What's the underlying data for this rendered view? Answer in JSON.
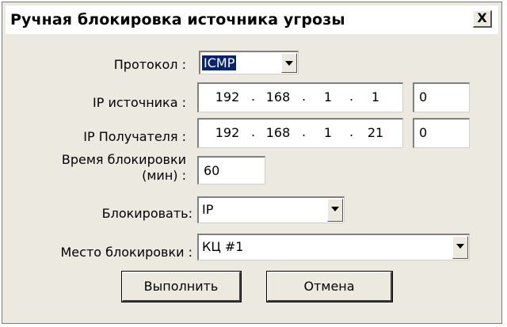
{
  "dialog": {
    "title": "Ручная блокировка источника угрозы",
    "close_glyph": "X"
  },
  "protocol": {
    "label": "Протокол :",
    "value": "ICMP"
  },
  "src_ip": {
    "label": "IP источника :",
    "octets": [
      "192",
      "168",
      "1",
      "1"
    ],
    "port": "0"
  },
  "dst_ip": {
    "label": "IP Получателя :",
    "octets": [
      "192",
      "168",
      "1",
      "21"
    ],
    "port": "0"
  },
  "block_time": {
    "label_line1": "Время блокировки",
    "label_line2": "(мин) :",
    "value": "60"
  },
  "block_what": {
    "label": "Блокировать:",
    "value": "IP"
  },
  "block_place": {
    "label": "Место блокировки :",
    "value": "КЦ #1"
  },
  "buttons": {
    "execute": "Выполнить",
    "cancel": "Отмена"
  },
  "ip_separator": "."
}
